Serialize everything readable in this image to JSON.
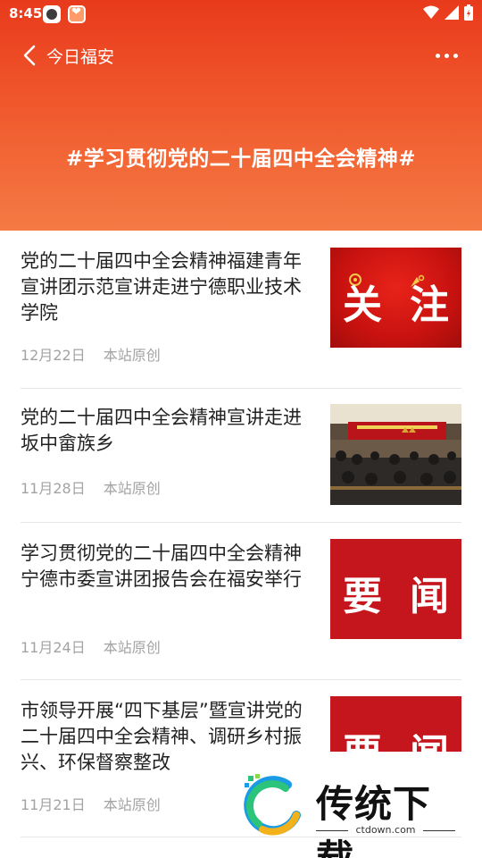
{
  "status_bar": {
    "time": "8:45",
    "icons": [
      "app-icon",
      "app-icon",
      "wifi-icon",
      "signal-icon",
      "battery-icon"
    ]
  },
  "nav": {
    "back_icon": "chevron-left-icon",
    "title": "今日福安",
    "more_icon": "more-dots-icon"
  },
  "hero": {
    "title": "#学习贯彻党的二十届四中全会精神#",
    "colors": {
      "top": "#e83a1c",
      "bottom": "#f47a44"
    }
  },
  "news": [
    {
      "title": "党的二十届四中全会精神福建青年宣讲团示范宣讲走进宁德职业技术学院",
      "date": "12月22日",
      "source": "本站原创",
      "thumb_type": "banner",
      "thumb_text": [
        "关",
        "注"
      ]
    },
    {
      "title": "党的二十届四中全会精神宣讲走进坂中畲族乡",
      "date": "11月28日",
      "source": "本站原创",
      "thumb_type": "photo",
      "thumb_text": []
    },
    {
      "title": "学习贯彻党的二十届四中全会精神宁德市委宣讲团报告会在福安举行",
      "date": "11月24日",
      "source": "本站原创",
      "thumb_type": "banner",
      "thumb_text": [
        "要",
        "闻"
      ]
    },
    {
      "title": "市领导开展“四下基层”暨宣讲党的二十届四中全会精神、调研乡村振兴、环保督察整改",
      "date": "11月21日",
      "source": "本站原创",
      "thumb_type": "banner",
      "thumb_text": [
        "要",
        "闻"
      ]
    }
  ],
  "watermark": {
    "text": "传统下载",
    "url": "ctdown.com"
  },
  "colors": {
    "accent": "#e83a1c",
    "meta_text": "#a3a3a3",
    "title_text": "#222222"
  }
}
